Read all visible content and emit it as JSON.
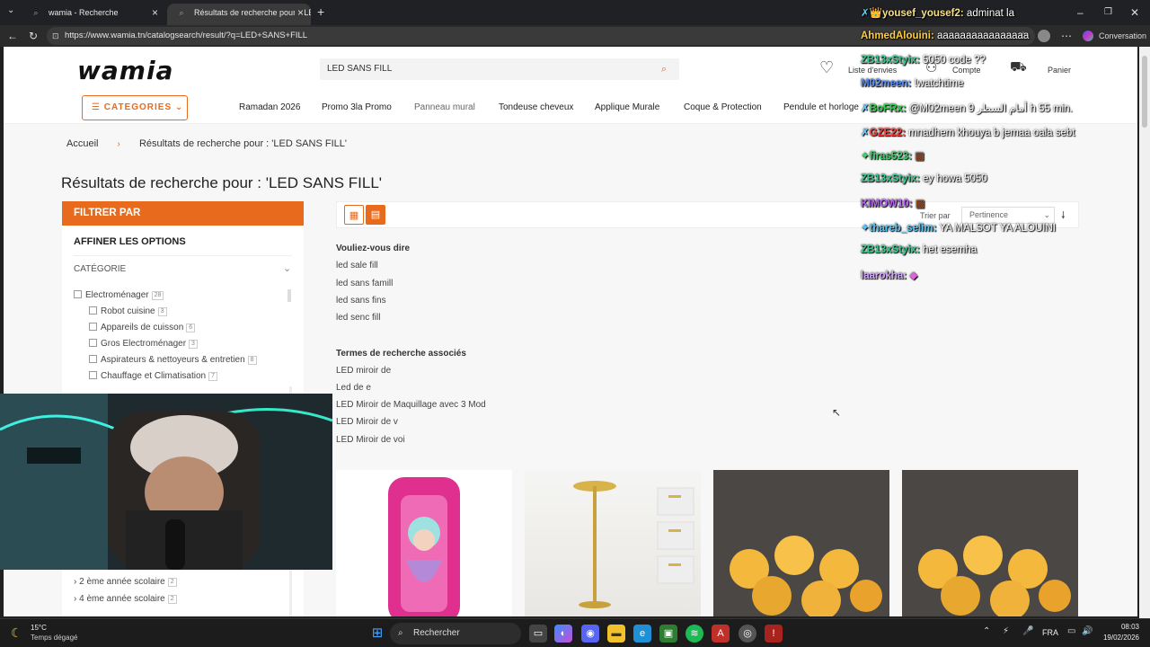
{
  "browser": {
    "tabs": [
      {
        "title": "wamia - Recherche",
        "active": false
      },
      {
        "title": "Résultats de recherche pour : 'LED",
        "active": true
      }
    ],
    "new_tab": "+",
    "url": "https://www.wamia.tn/catalogsearch/result/?q=LED+SANS+FILL",
    "conversation_label": "Conversation"
  },
  "header": {
    "logo": "wamia",
    "search_value": "LED SANS FILL",
    "wishlist_label": "Liste d'envies",
    "account_label": "Compte",
    "cart_label": "Panier"
  },
  "nav": {
    "categories_label": "CATEGORIES",
    "links": [
      "Ramadan 2026",
      "Promo 3la Promo",
      "Panneau mural",
      "Tondeuse cheveux",
      "Applique Murale",
      "Coque & Protection",
      "Pendule et horloge"
    ]
  },
  "breadcrumb": {
    "home": "Accueil",
    "sep": "›",
    "current": "Résultats de recherche pour : 'LED SANS FILL'"
  },
  "page_title": "Résultats de recherche pour : 'LED SANS FILL'",
  "sidebar": {
    "filter_header": "FILTRER PAR",
    "refine_title": "AFFINER LES OPTIONS",
    "category_title": "CATÉGORIE",
    "categories": [
      {
        "label": "Electroménager",
        "count": "28",
        "level": 0
      },
      {
        "label": "Robot cuisine",
        "count": "3",
        "level": 1
      },
      {
        "label": "Appareils de cuisson",
        "count": "6",
        "level": 1
      },
      {
        "label": "Gros Electroménager",
        "count": "3",
        "level": 1
      },
      {
        "label": "Aspirateurs & nettoyeurs & entretien",
        "count": "8",
        "level": 1
      },
      {
        "label": "Chauffage et Climatisation",
        "count": "7",
        "level": 1
      }
    ],
    "school_items": [
      {
        "label": "2 ème année scolaire",
        "count": "2"
      },
      {
        "label": "4 ème année scolaire",
        "count": "2"
      }
    ]
  },
  "results": {
    "sort_label": "Trier par",
    "sort_value": "Pertinence",
    "did_you_mean_title": "Vouliez-vous dire",
    "suggestions": [
      "led sale fill",
      "led sans famill",
      "led sans fins",
      "led senc fill"
    ],
    "related_title": "Termes de recherche associés",
    "related": [
      "LED miroir de",
      "Led de e",
      "LED Miroir de Maquillage avec 3 Mod",
      "LED Miroir de v",
      "LED Miroir de voi"
    ]
  },
  "chat": [
    {
      "user": "yousef_yousef2:",
      "msg": " adminat la",
      "color": "#f6e08a",
      "badge": "✗👑"
    },
    {
      "user": "AhmedAlouini:",
      "msg": " aaaaaaaaaaaaaaaa",
      "color": "#ffcf3f",
      "badge": ""
    },
    {
      "user": "ZB13xStyix:",
      "msg": " 5050 code ??",
      "color": "#3cc98f",
      "badge": ""
    },
    {
      "user": "M02meen:",
      "msg": " !watchtime",
      "color": "#5d8df0",
      "badge": ""
    },
    {
      "user": "BoFRx:",
      "msg": " @M02meen 9 أمام السطر h 55 min.",
      "color": "#31d14f",
      "badge": "✗"
    },
    {
      "user": "GZE22:",
      "msg": " mnadhem khouya b jemaa oala sebt",
      "color": "#ff3d3d",
      "badge": "✗"
    },
    {
      "user": "firas523:",
      "msg": " ▩",
      "color": "#3ad36b",
      "badge": "✦"
    },
    {
      "user": "ZB13xStyix:",
      "msg": " ey howa 5050",
      "color": "#3cc98f",
      "badge": ""
    },
    {
      "user": "KIMOW10:",
      "msg": " ▩",
      "color": "#b565f0",
      "badge": ""
    },
    {
      "user": "thareb_selim:",
      "msg": " YA MALSOT YA ALOUINI",
      "color": "#55c7f7",
      "badge": "✦"
    },
    {
      "user": "ZB13xStyix:",
      "msg": " het esemha",
      "color": "#3cc98f",
      "badge": ""
    },
    {
      "user": "laarokha:",
      "msg": " ◆",
      "color": "#d6a7ff",
      "badge": ""
    }
  ],
  "taskbar": {
    "weather_temp": "15°C",
    "weather_desc": "Temps dégagé",
    "search_label": "Rechercher",
    "lang": "FRA",
    "time": "08:03",
    "date": "19/02/2026"
  },
  "colors": {
    "accent": "#e86a1c",
    "page_bg": "#f7f7f7"
  }
}
